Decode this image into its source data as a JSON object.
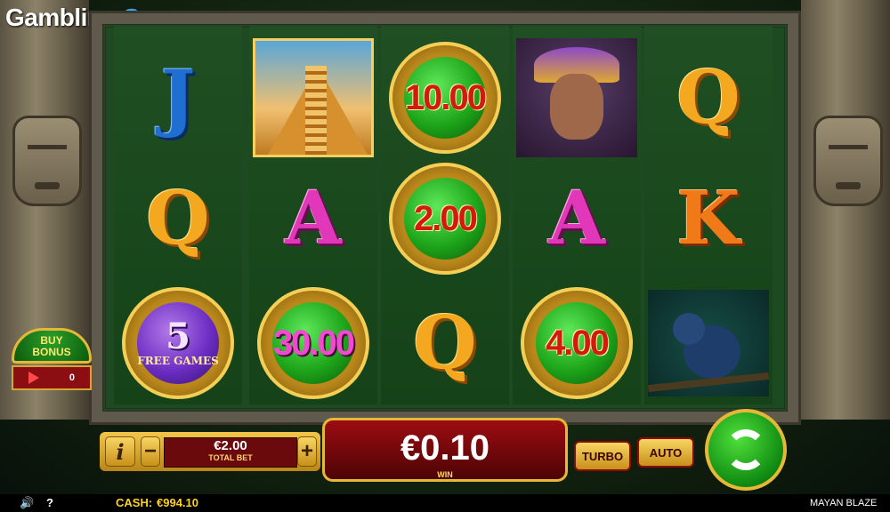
{
  "brand": {
    "part1": "Gambling",
    "part2": "Space"
  },
  "game_title": "MAYAN BLAZE",
  "reels": [
    [
      {
        "kind": "letter",
        "text": "J",
        "cls": "j"
      },
      {
        "kind": "letter",
        "text": "Q",
        "cls": "q"
      },
      {
        "kind": "freegames",
        "num": "5",
        "label": "FREE GAMES"
      }
    ],
    [
      {
        "kind": "pyramid"
      },
      {
        "kind": "letter",
        "text": "A",
        "cls": "a"
      },
      {
        "kind": "coin",
        "value": "30.00",
        "pink": true
      }
    ],
    [
      {
        "kind": "coin",
        "value": "10.00"
      },
      {
        "kind": "coin",
        "value": "2.00"
      },
      {
        "kind": "letter",
        "text": "Q",
        "cls": "q"
      }
    ],
    [
      {
        "kind": "portrait"
      },
      {
        "kind": "letter",
        "text": "A",
        "cls": "a"
      },
      {
        "kind": "coin",
        "value": "4.00"
      }
    ],
    [
      {
        "kind": "letter",
        "text": "Q",
        "cls": "q"
      },
      {
        "kind": "letter",
        "text": "K",
        "cls": "k"
      },
      {
        "kind": "monkey"
      }
    ]
  ],
  "buy_bonus": {
    "line1": "BUY",
    "line2": "BONUS",
    "count": "0"
  },
  "controls": {
    "info": "i",
    "minus": "−",
    "plus": "+",
    "bet_value": "€2.00",
    "bet_label": "TOTAL BET",
    "win_value": "€0.10",
    "win_label": "WIN",
    "turbo": "TURBO",
    "auto": "AUTO"
  },
  "statusbar": {
    "sound_icon": "speaker-icon",
    "help": "?",
    "cash_label": "CASH:",
    "cash_value": "€994.10",
    "game_name": "MAYAN BLAZE"
  }
}
